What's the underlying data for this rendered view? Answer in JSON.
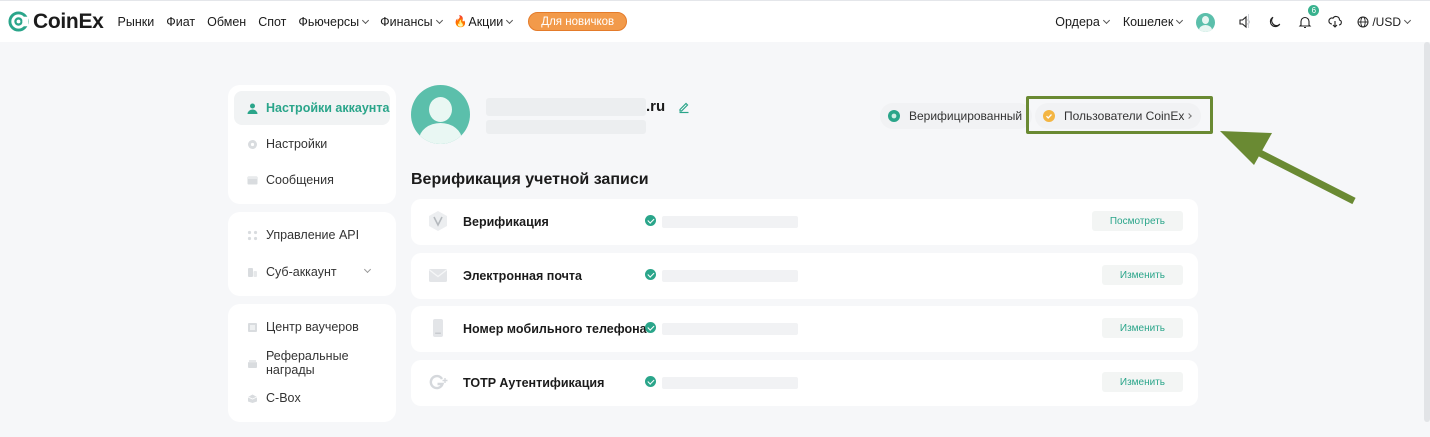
{
  "brand": {
    "name": "CoinEx"
  },
  "nav": {
    "items": [
      {
        "label": "Рынки",
        "dropdown": false
      },
      {
        "label": "Фиат",
        "dropdown": false
      },
      {
        "label": "Обмен",
        "dropdown": false
      },
      {
        "label": "Спот",
        "dropdown": false
      },
      {
        "label": "Фьючерсы",
        "dropdown": true
      },
      {
        "label": "Финансы",
        "dropdown": true
      },
      {
        "label": "Акции",
        "dropdown": true,
        "icon": "fire-icon"
      }
    ],
    "promo_button": "Для новичков"
  },
  "topbar_right": {
    "orders": "Ордера",
    "wallet": "Кошелек",
    "notifications_count": "6",
    "currency": "/USD",
    "icons": [
      "avatar",
      "sound-icon",
      "moon-icon",
      "bell-icon",
      "download-icon",
      "globe-icon"
    ]
  },
  "sidebar": {
    "group1": [
      {
        "label": "Настройки аккаунта",
        "icon": "user-icon",
        "active": true
      },
      {
        "label": "Настройки",
        "icon": "settings-icon"
      },
      {
        "label": "Сообщения",
        "icon": "message-icon"
      }
    ],
    "group2": [
      {
        "label": "Управление API",
        "icon": "api-icon"
      },
      {
        "label": "Суб-аккаунт",
        "icon": "sub-account-icon",
        "expandable": true
      }
    ],
    "group3": [
      {
        "label": "Центр ваучеров",
        "icon": "voucher-icon"
      },
      {
        "label": "Реферальные награды",
        "icon": "referral-icon"
      },
      {
        "label": "C-Box",
        "icon": "cbox-icon"
      }
    ]
  },
  "profile": {
    "email_suffix": ".ru",
    "verified_label": "Верифицированный",
    "users_label": "Пользователи CoinEx"
  },
  "verification": {
    "title": "Верификация учетной записи",
    "rows": [
      {
        "label": "Верификация",
        "icon": "verification-v-icon",
        "action": "Посмотреть"
      },
      {
        "label": "Электронная почта",
        "icon": "email-icon",
        "action": "Изменить"
      },
      {
        "label": "Номер мобильного телефона",
        "icon": "phone-icon",
        "action": "Изменить"
      },
      {
        "label": "TOTP Аутентификация",
        "icon": "google-auth-icon",
        "action": "Изменить"
      }
    ]
  },
  "colors": {
    "accent": "#2aa58a",
    "promo": "#f29a4a",
    "highlight_box": "#6a8a33",
    "arrow": "#6a8a33"
  }
}
